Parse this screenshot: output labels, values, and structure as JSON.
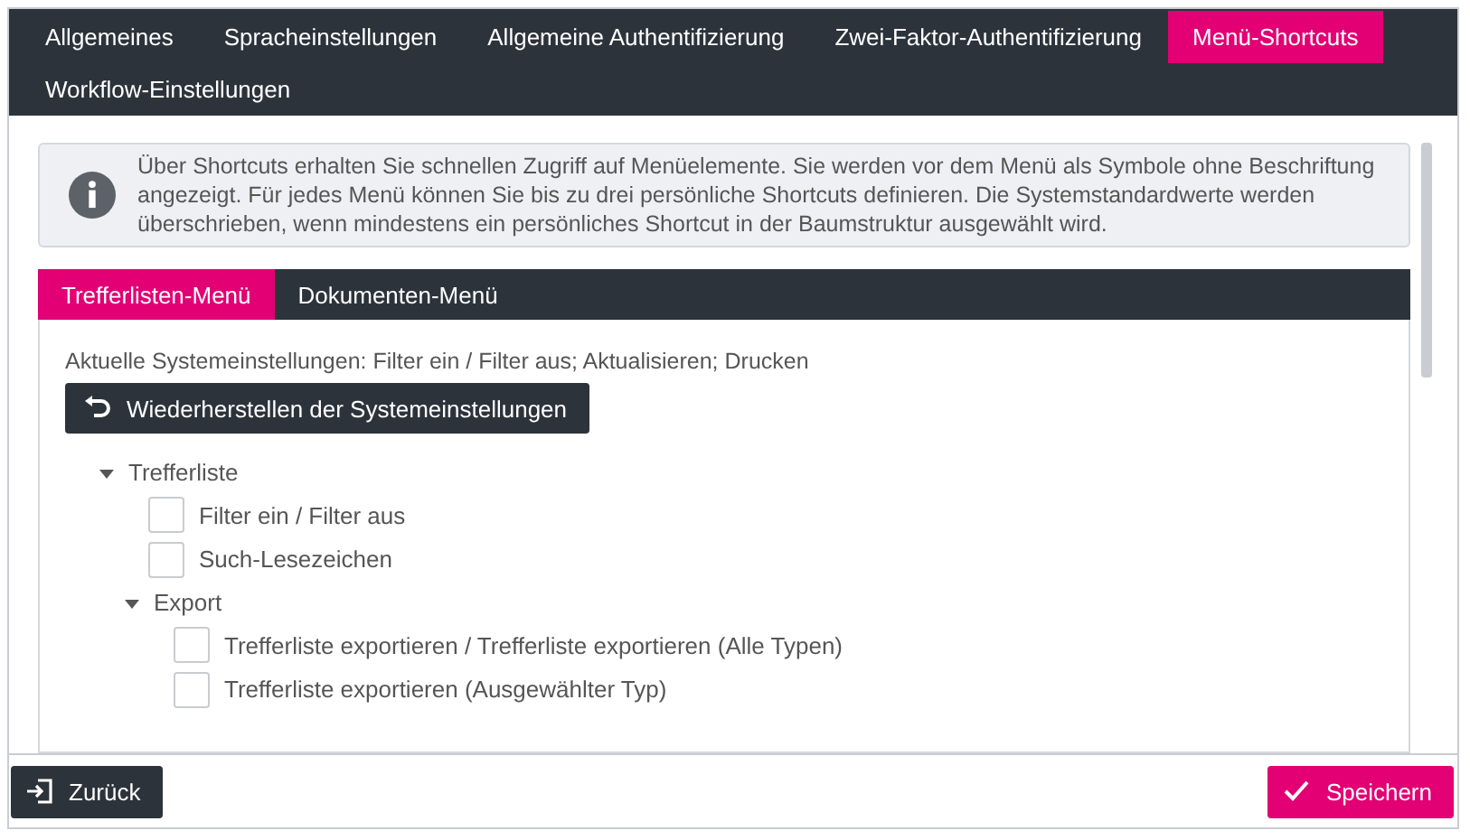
{
  "tabs": [
    {
      "label": "Allgemeines",
      "selected": false
    },
    {
      "label": "Spracheinstellungen",
      "selected": false
    },
    {
      "label": "Allgemeine Authentifizierung",
      "selected": false
    },
    {
      "label": "Zwei-Faktor-Authentifizierung",
      "selected": false
    },
    {
      "label": "Menü-Shortcuts",
      "selected": true
    },
    {
      "label": "Workflow-Einstellungen",
      "selected": false
    }
  ],
  "info": "Über Shortcuts erhalten Sie schnellen Zugriff auf Menüelemente. Sie werden vor dem Menü als Symbole ohne Beschriftung angezeigt. Für jedes Menü können Sie bis zu drei persönliche Shortcuts definieren. Die Systemstandardwerte werden überschrieben, wenn mindestens ein persönliches Shortcut in der Baumstruktur ausgewählt wird.",
  "subtabs": [
    {
      "label": "Trefferlisten-Menü",
      "selected": true
    },
    {
      "label": "Dokumenten-Menü",
      "selected": false
    }
  ],
  "current_settings": "Aktuelle Systemeinstellungen: Filter ein / Filter aus; Aktualisieren; Drucken",
  "restore_button": "Wiederherstellen der Systemeinstellungen",
  "tree": [
    {
      "kind": "group",
      "label": "Trefferliste",
      "expanded": true,
      "children": [
        {
          "kind": "check",
          "label": "Filter ein / Filter aus",
          "checked": false
        },
        {
          "kind": "check",
          "label": "Such-Lesezeichen",
          "checked": false
        },
        {
          "kind": "group",
          "label": "Export",
          "expanded": true,
          "children": [
            {
              "kind": "check",
              "label": "Trefferliste exportieren / Trefferliste exportieren (Alle Typen)",
              "checked": false
            },
            {
              "kind": "check",
              "label": "Trefferliste exportieren (Ausgewählter Typ)",
              "checked": false
            }
          ]
        }
      ]
    }
  ],
  "back_button": "Zurück",
  "save_button": "Speichern"
}
